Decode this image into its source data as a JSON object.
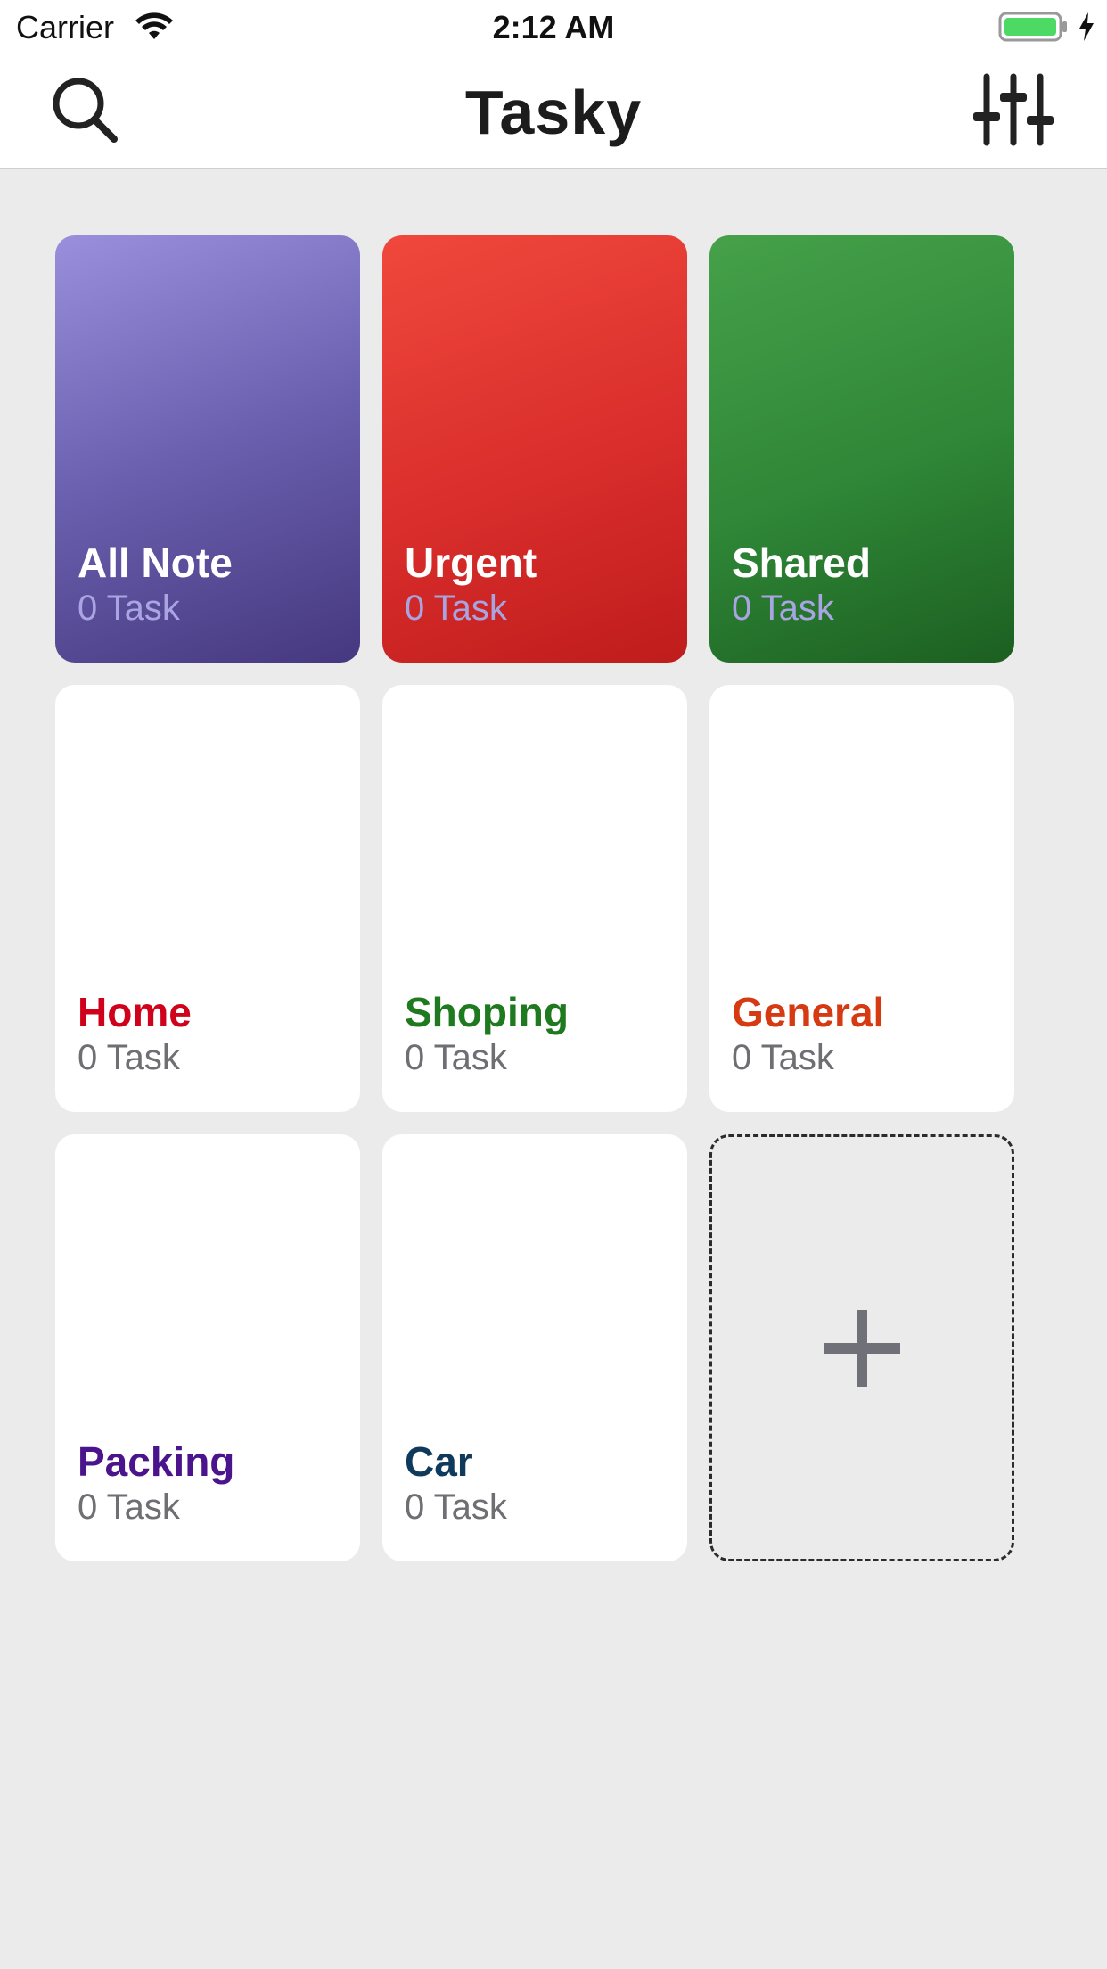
{
  "status_bar": {
    "carrier": "Carrier",
    "time": "2:12 AM",
    "battery_color": "#4cd964"
  },
  "nav": {
    "title": "Tasky",
    "left_icon": "search-icon",
    "right_icon": "sliders-icon"
  },
  "cards": [
    {
      "name": "All Note",
      "count": "0 Task",
      "style": "gradient",
      "color": "#6a5fae"
    },
    {
      "name": "Urgent",
      "count": "0 Task",
      "style": "gradient",
      "color": "#d92e2c"
    },
    {
      "name": "Shared",
      "count": "0 Task",
      "style": "gradient",
      "color": "#2f8737"
    },
    {
      "name": "Home",
      "count": "0 Task",
      "style": "white",
      "color": "#d0021b"
    },
    {
      "name": "Shoping",
      "count": "0 Task",
      "style": "white",
      "color": "#1f7a1f"
    },
    {
      "name": "General",
      "count": "0 Task",
      "style": "white",
      "color": "#d63a12"
    },
    {
      "name": "Packing",
      "count": "0 Task",
      "style": "white",
      "color": "#4b148c"
    },
    {
      "name": "Car",
      "count": "0 Task",
      "style": "white",
      "color": "#0f3a5c"
    }
  ],
  "add_card": {
    "icon": "plus-icon",
    "color": "#707078"
  }
}
